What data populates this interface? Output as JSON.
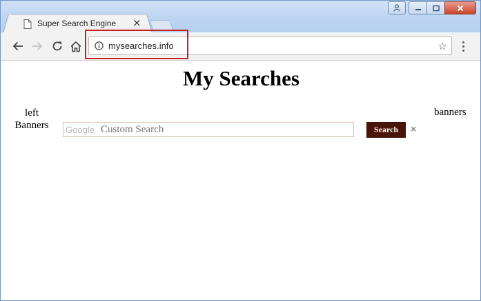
{
  "browser": {
    "tab": {
      "title": "Super Search Engine",
      "icon": "page-icon",
      "close_icon": "close-icon"
    },
    "toolbar": {
      "back_icon": "back-arrow-icon",
      "forward_icon": "forward-arrow-icon",
      "reload_icon": "reload-icon",
      "home_icon": "home-icon",
      "menu_icon": "kebab-menu-icon"
    },
    "omnibox": {
      "url": "mysearches.info",
      "info_icon": "info-icon",
      "bookmark_icon": "star-icon"
    },
    "highlight_color": "#c41f23"
  },
  "page": {
    "title": "My Searches",
    "left_banner": {
      "line1": "left",
      "line2": "Banners"
    },
    "right_banner": "banners",
    "search": {
      "brand": "Google",
      "placeholder": "Custom Search",
      "button_label": "Search",
      "button_color": "#4a1508",
      "clear_label": "×"
    }
  }
}
